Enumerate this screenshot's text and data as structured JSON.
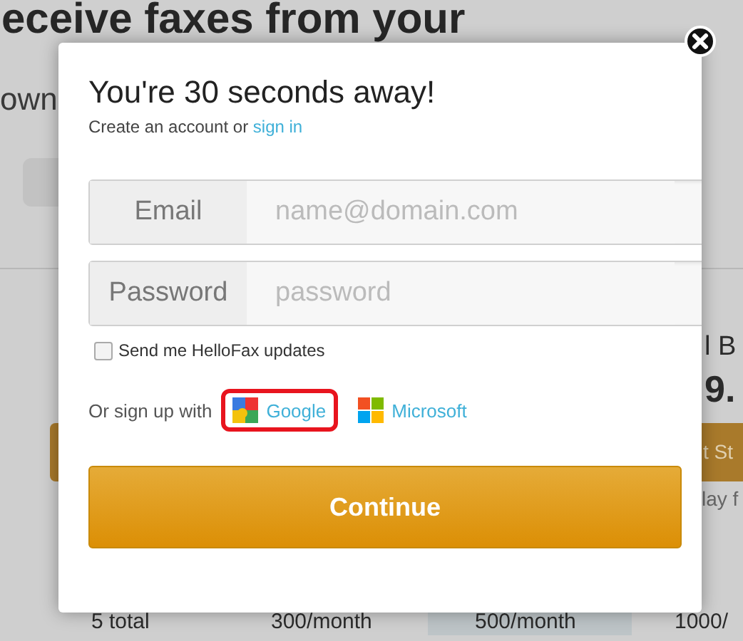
{
  "background": {
    "heading": "eceive faxes from your",
    "subheading": "own",
    "plan_title": "l B",
    "plan_price": "9.",
    "plan_button": "t St",
    "plan_note": "lay f",
    "usage_row": [
      {
        "text": "5 total",
        "highlighted": false
      },
      {
        "text": "300/month",
        "highlighted": false
      },
      {
        "text": "500/month",
        "highlighted": true
      },
      {
        "text": "1000/",
        "highlighted": false
      }
    ]
  },
  "modal": {
    "title": "You're 30 seconds away!",
    "subtitle": "Create an account or ",
    "subtitle_link": "sign in",
    "fields": [
      {
        "label": "Email",
        "placeholder": "name@domain.com"
      },
      {
        "label": "Password",
        "placeholder": "password"
      }
    ],
    "updates_checkbox": {
      "label": "Send me HelloFax updates",
      "checked": false
    },
    "signup_prompt": "Or sign up with",
    "providers": [
      {
        "kind": "google",
        "label": "Google",
        "highlighted": true
      },
      {
        "kind": "microsoft",
        "label": "Microsoft",
        "highlighted": false
      }
    ],
    "button": "Continue"
  }
}
